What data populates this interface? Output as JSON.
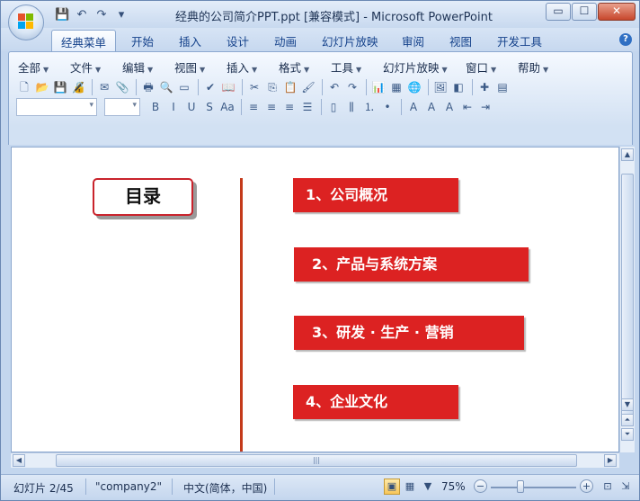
{
  "window": {
    "title": "经典的公司简介PPT.ppt [兼容模式] - Microsoft PowerPoint",
    "controls": {
      "minimize": "▭",
      "maximize": "☐",
      "close": "✕"
    }
  },
  "quick_access": [
    {
      "name": "save-icon",
      "glyph": "💾"
    },
    {
      "name": "undo-icon",
      "glyph": "↶"
    },
    {
      "name": "redo-icon",
      "glyph": "↷"
    },
    {
      "name": "customize-icon",
      "glyph": "▾"
    }
  ],
  "tabs": [
    {
      "label": "经典菜单",
      "active": true
    },
    {
      "label": "开始"
    },
    {
      "label": "插入"
    },
    {
      "label": "设计"
    },
    {
      "label": "动画"
    },
    {
      "label": "幻灯片放映"
    },
    {
      "label": "审阅"
    },
    {
      "label": "视图"
    },
    {
      "label": "开发工具"
    }
  ],
  "help": "?",
  "menu": [
    {
      "label": "全部"
    },
    {
      "label": "文件"
    },
    {
      "label": "编辑"
    },
    {
      "label": "视图"
    },
    {
      "label": "插入"
    },
    {
      "label": "格式"
    },
    {
      "label": "工具"
    },
    {
      "label": "幻灯片放映"
    },
    {
      "label": "窗口"
    },
    {
      "label": "帮助"
    }
  ],
  "toolbar1": [
    {
      "name": "new-icon",
      "glyph": "🗋"
    },
    {
      "name": "open-icon",
      "glyph": "📂"
    },
    {
      "name": "save-icon",
      "glyph": "💾"
    },
    {
      "name": "permission-icon",
      "glyph": "🔏"
    },
    {
      "name": "sep"
    },
    {
      "name": "email-icon",
      "glyph": "✉"
    },
    {
      "name": "attach-icon",
      "glyph": "📎"
    },
    {
      "name": "sep"
    },
    {
      "name": "print-icon",
      "glyph": "🖶"
    },
    {
      "name": "print-preview-icon",
      "glyph": "🔍"
    },
    {
      "name": "page-setup-icon",
      "glyph": "▭"
    },
    {
      "name": "sep"
    },
    {
      "name": "spellcheck-icon",
      "glyph": "✔"
    },
    {
      "name": "research-icon",
      "glyph": "📖"
    },
    {
      "name": "sep"
    },
    {
      "name": "cut-icon",
      "glyph": "✂"
    },
    {
      "name": "copy-icon",
      "glyph": "⎘"
    },
    {
      "name": "paste-icon",
      "glyph": "📋"
    },
    {
      "name": "format-painter-icon",
      "glyph": "🖌"
    },
    {
      "name": "sep"
    },
    {
      "name": "undo-icon",
      "glyph": "↶"
    },
    {
      "name": "redo-icon",
      "glyph": "↷"
    },
    {
      "name": "sep"
    },
    {
      "name": "chart-icon",
      "glyph": "📊"
    },
    {
      "name": "table-icon",
      "glyph": "▦"
    },
    {
      "name": "hyperlink-icon",
      "glyph": "🌐"
    },
    {
      "name": "sep"
    },
    {
      "name": "picture-icon",
      "glyph": "🖼"
    },
    {
      "name": "color-grayscale-icon",
      "glyph": "◧"
    },
    {
      "name": "sep"
    },
    {
      "name": "new-slide-icon",
      "glyph": "✚"
    },
    {
      "name": "slide-design-icon",
      "glyph": "▤"
    }
  ],
  "toolbar2": [
    {
      "name": "bold-icon",
      "glyph": "B"
    },
    {
      "name": "italic-icon",
      "glyph": "I"
    },
    {
      "name": "underline-icon",
      "glyph": "U"
    },
    {
      "name": "shadow-icon",
      "glyph": "S"
    },
    {
      "name": "change-case-icon",
      "glyph": "Aa"
    },
    {
      "name": "sep"
    },
    {
      "name": "align-left-icon",
      "glyph": "≡"
    },
    {
      "name": "align-center-icon",
      "glyph": "≡"
    },
    {
      "name": "align-right-icon",
      "glyph": "≡"
    },
    {
      "name": "justify-icon",
      "glyph": "☰"
    },
    {
      "name": "sep"
    },
    {
      "name": "text-box-icon",
      "glyph": "▯"
    },
    {
      "name": "columns-icon",
      "glyph": "⫼"
    },
    {
      "name": "numbering-icon",
      "glyph": "⒈"
    },
    {
      "name": "bullets-icon",
      "glyph": "•"
    },
    {
      "name": "sep"
    },
    {
      "name": "font-color-icon",
      "glyph": "A"
    },
    {
      "name": "increase-font-icon",
      "glyph": "A"
    },
    {
      "name": "decrease-font-icon",
      "glyph": "A"
    },
    {
      "name": "decrease-indent-icon",
      "glyph": "⇤"
    },
    {
      "name": "increase-indent-icon",
      "glyph": "⇥"
    }
  ],
  "slide": {
    "toc_title": "目录",
    "items": [
      {
        "label": "1、公司概况"
      },
      {
        "label": "2、产品与系统方案"
      },
      {
        "label": "3、研发 · 生产 · 营销"
      },
      {
        "label": "4、企业文化"
      }
    ]
  },
  "status": {
    "slide_info": "幻灯片 2/45",
    "theme": "\"company2\"",
    "language": "中文(简体，中国)",
    "zoom": "75%",
    "zoom_level": 0.75
  },
  "colors": {
    "accent_red": "#dc2222",
    "divider": "#c43a1a",
    "ribbon_blue": "#dbe7f6"
  }
}
